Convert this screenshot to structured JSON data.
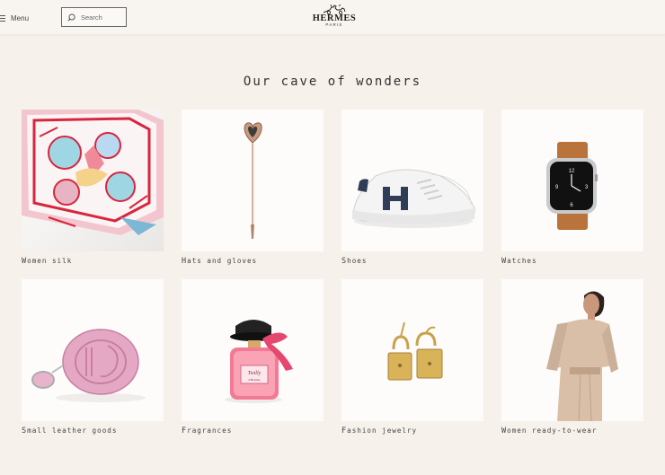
{
  "header": {
    "menu_label": "Menu",
    "search_placeholder": "Search",
    "logo": {
      "brand": "HERMES",
      "city": "PARIS"
    }
  },
  "main": {
    "title": "Our cave of wonders",
    "categories": [
      {
        "label": "Women silk",
        "icon": "silk-scarf-image"
      },
      {
        "label": "Hats and gloves",
        "icon": "pin-image"
      },
      {
        "label": "Shoes",
        "icon": "sneaker-image"
      },
      {
        "label": "Watches",
        "icon": "watch-image"
      },
      {
        "label": "Small leather goods",
        "icon": "leather-pouch-image"
      },
      {
        "label": "Fragrances",
        "icon": "perfume-image"
      },
      {
        "label": "Fashion jewelry",
        "icon": "earrings-image"
      },
      {
        "label": "Women ready-to-wear",
        "icon": "model-image"
      }
    ]
  },
  "colors": {
    "background": "#f6f1eb",
    "card": "#fdfcfa",
    "text": "#444444"
  }
}
